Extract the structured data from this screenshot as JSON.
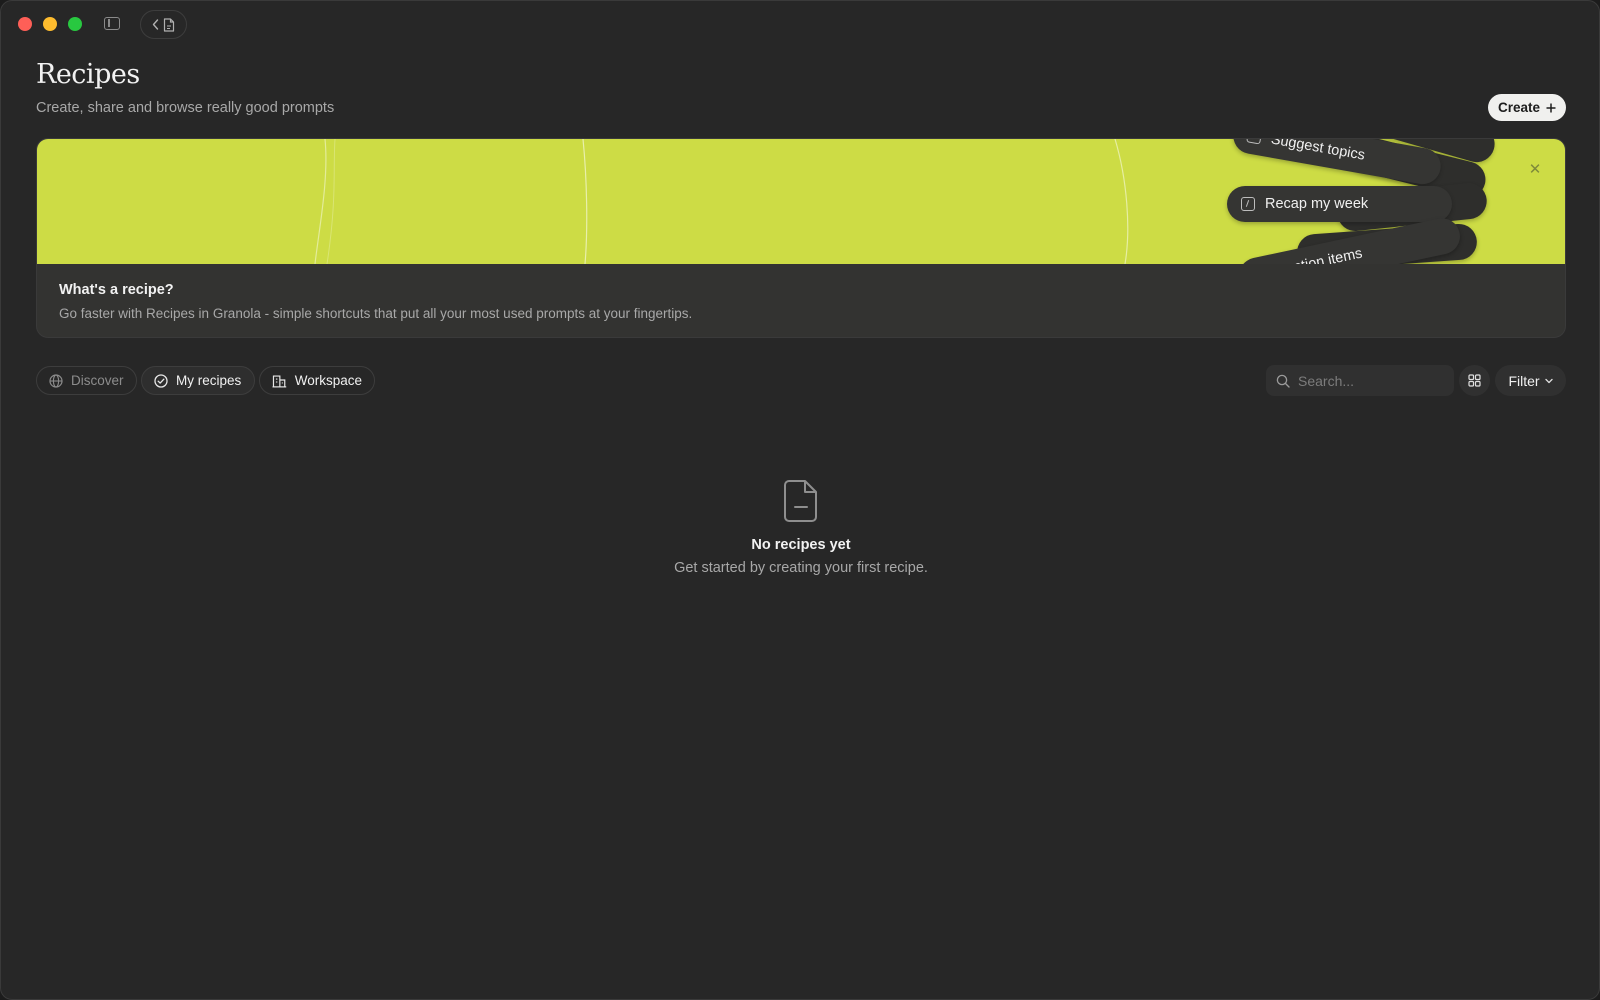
{
  "window": {
    "traffic_lights": [
      "close",
      "minimize",
      "maximize"
    ]
  },
  "header": {
    "title": "Recipes",
    "subtitle": "Create, share and browse really good prompts",
    "create_label": "Create",
    "create_icon": "plus-icon"
  },
  "banner": {
    "chips": [
      "Suggest topics",
      "Recap my week",
      "List action items"
    ],
    "chips_visible": [
      "Suggest topics",
      "Recap my week",
      "t action items"
    ],
    "heading": "What's a recipe?",
    "description": "Go faster with Recipes in Granola - simple shortcuts that put all your most used prompts at your fingertips.",
    "close_icon": "close-icon",
    "accent_color": "#cddc45"
  },
  "tabs": [
    {
      "label": "Discover",
      "icon": "globe-icon",
      "active": false
    },
    {
      "label": "My recipes",
      "icon": "check-circle-icon",
      "active": true
    },
    {
      "label": "Workspace",
      "icon": "building-icon",
      "active": false
    }
  ],
  "toolbar": {
    "search_placeholder": "Search...",
    "filter_label": "Filter",
    "grid_icon": "grid-icon"
  },
  "empty_state": {
    "icon": "document-icon",
    "title": "No recipes yet",
    "description": "Get started by creating your first recipe."
  }
}
